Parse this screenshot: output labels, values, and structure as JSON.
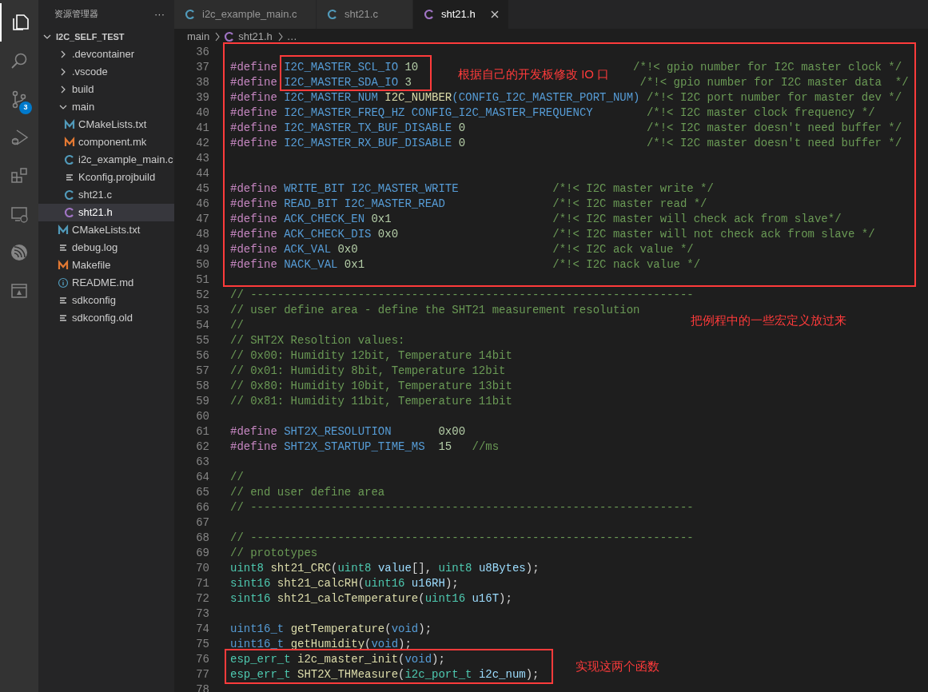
{
  "activity_bar": {
    "items": [
      {
        "kind": "files",
        "selected": true
      },
      {
        "kind": "search",
        "selected": false
      },
      {
        "kind": "scm",
        "selected": false,
        "badge": "3"
      },
      {
        "kind": "debug",
        "selected": false
      },
      {
        "kind": "extensions",
        "selected": false
      },
      {
        "kind": "remote",
        "selected": false
      },
      {
        "kind": "espressif",
        "selected": false
      },
      {
        "kind": "panel",
        "selected": false
      }
    ]
  },
  "sidebar": {
    "title": "资源管理器",
    "more": "···",
    "tree": [
      {
        "label": "I2C_SELF_TEST",
        "kind": "root",
        "expanded": true,
        "selected": false,
        "children": [
          {
            "label": ".devcontainer",
            "kind": "folder",
            "expanded": false,
            "selected": false
          },
          {
            "label": ".vscode",
            "kind": "folder",
            "expanded": false,
            "selected": false
          },
          {
            "label": "build",
            "kind": "folder",
            "expanded": false,
            "selected": false
          },
          {
            "label": "main",
            "kind": "folder",
            "expanded": true,
            "selected": false,
            "children": [
              {
                "label": "CMakeLists.txt",
                "kind": "cmake",
                "selected": false
              },
              {
                "label": "component.mk",
                "kind": "make",
                "selected": false
              },
              {
                "label": "i2c_example_main.c",
                "kind": "c",
                "selected": false
              },
              {
                "label": "Kconfig.projbuild",
                "kind": "text",
                "selected": false
              },
              {
                "label": "sht21.c",
                "kind": "c",
                "selected": false
              },
              {
                "label": "sht21.h",
                "kind": "h",
                "selected": true
              }
            ]
          },
          {
            "label": "CMakeLists.txt",
            "kind": "cmake",
            "selected": false
          },
          {
            "label": "debug.log",
            "kind": "text",
            "selected": false
          },
          {
            "label": "Makefile",
            "kind": "make",
            "selected": false
          },
          {
            "label": "README.md",
            "kind": "info",
            "selected": false
          },
          {
            "label": "sdkconfig",
            "kind": "text",
            "selected": false
          },
          {
            "label": "sdkconfig.old",
            "kind": "text",
            "selected": false
          }
        ]
      }
    ]
  },
  "tabs": [
    {
      "label": "i2c_example_main.c",
      "kind": "c",
      "selected": false
    },
    {
      "label": "sht21.c",
      "kind": "c",
      "selected": false
    },
    {
      "label": "sht21.h",
      "kind": "h",
      "selected": true
    }
  ],
  "breadcrumb": [
    {
      "label": "main",
      "kind": "folder"
    },
    {
      "label": "sht21.h",
      "kind": "h"
    },
    {
      "label": "…",
      "kind": "more"
    }
  ],
  "code": [
    {
      "number": "36"
    },
    {
      "number": "37",
      "tokens": [
        {
          "kind": "dir",
          "text": "#define "
        },
        {
          "kind": "macro",
          "text": "I2C_MASTER_SCL_IO "
        },
        {
          "kind": "num",
          "text": "10                                "
        },
        {
          "kind": "comment",
          "text": "/*!< gpio number for I2C master clock */"
        }
      ]
    },
    {
      "number": "38",
      "tokens": [
        {
          "kind": "dir",
          "text": "#define "
        },
        {
          "kind": "macro",
          "text": "I2C_MASTER_SDA_IO "
        },
        {
          "kind": "num",
          "text": "3                                  "
        },
        {
          "kind": "comment",
          "text": "/*!< gpio number for I2C master data  */"
        }
      ]
    },
    {
      "number": "39",
      "tokens": [
        {
          "kind": "dir",
          "text": "#define "
        },
        {
          "kind": "macro",
          "text": "I2C_MASTER_NUM "
        },
        {
          "kind": "func",
          "text": "I2C_NUMBER"
        },
        {
          "kind": "macro",
          "text": "(CONFIG_I2C_MASTER_PORT_NUM) "
        },
        {
          "kind": "comment",
          "text": "/*!< I2C port number for master dev */"
        }
      ]
    },
    {
      "number": "40",
      "tokens": [
        {
          "kind": "dir",
          "text": "#define "
        },
        {
          "kind": "macro",
          "text": "I2C_MASTER_FREQ_HZ CONFIG_I2C_MASTER_FREQUENCY        "
        },
        {
          "kind": "comment",
          "text": "/*!< I2C master clock frequency */"
        }
      ]
    },
    {
      "number": "41",
      "tokens": [
        {
          "kind": "dir",
          "text": "#define "
        },
        {
          "kind": "macro",
          "text": "I2C_MASTER_TX_BUF_DISABLE "
        },
        {
          "kind": "num",
          "text": "0                           "
        },
        {
          "kind": "comment",
          "text": "/*!< I2C master doesn't need buffer */"
        }
      ]
    },
    {
      "number": "42",
      "tokens": [
        {
          "kind": "dir",
          "text": "#define "
        },
        {
          "kind": "macro",
          "text": "I2C_MASTER_RX_BUF_DISABLE "
        },
        {
          "kind": "num",
          "text": "0                           "
        },
        {
          "kind": "comment",
          "text": "/*!< I2C master doesn't need buffer */"
        }
      ]
    },
    {
      "number": "43"
    },
    {
      "number": "44"
    },
    {
      "number": "45",
      "tokens": [
        {
          "kind": "dir",
          "text": "#define "
        },
        {
          "kind": "macro",
          "text": "WRITE_BIT I2C_MASTER_WRITE              "
        },
        {
          "kind": "comment",
          "text": "/*!< I2C master write */"
        }
      ]
    },
    {
      "number": "46",
      "tokens": [
        {
          "kind": "dir",
          "text": "#define "
        },
        {
          "kind": "macro",
          "text": "READ_BIT I2C_MASTER_READ                "
        },
        {
          "kind": "comment",
          "text": "/*!< I2C master read */"
        }
      ]
    },
    {
      "number": "47",
      "tokens": [
        {
          "kind": "dir",
          "text": "#define "
        },
        {
          "kind": "macro",
          "text": "ACK_CHECK_EN "
        },
        {
          "kind": "num",
          "text": "0x1                        "
        },
        {
          "kind": "comment",
          "text": "/*!< I2C master will check ack from slave*/"
        }
      ]
    },
    {
      "number": "48",
      "tokens": [
        {
          "kind": "dir",
          "text": "#define "
        },
        {
          "kind": "macro",
          "text": "ACK_CHECK_DIS "
        },
        {
          "kind": "num",
          "text": "0x0                       "
        },
        {
          "kind": "comment",
          "text": "/*!< I2C master will not check ack from slave */"
        }
      ]
    },
    {
      "number": "49",
      "tokens": [
        {
          "kind": "dir",
          "text": "#define "
        },
        {
          "kind": "macro",
          "text": "ACK_VAL "
        },
        {
          "kind": "num",
          "text": "0x0                             "
        },
        {
          "kind": "comment",
          "text": "/*!< I2C ack value */"
        }
      ]
    },
    {
      "number": "50",
      "tokens": [
        {
          "kind": "dir",
          "text": "#define "
        },
        {
          "kind": "macro",
          "text": "NACK_VAL "
        },
        {
          "kind": "num",
          "text": "0x1                            "
        },
        {
          "kind": "comment",
          "text": "/*!< I2C nack value */"
        }
      ]
    },
    {
      "number": "51"
    },
    {
      "number": "52",
      "tokens": [
        {
          "kind": "comment",
          "text": "// ------------------------------------------------------------------"
        }
      ]
    },
    {
      "number": "53",
      "tokens": [
        {
          "kind": "comment",
          "text": "// user define area - define the SHT21 measurement resolution"
        }
      ]
    },
    {
      "number": "54",
      "tokens": [
        {
          "kind": "comment",
          "text": "//"
        }
      ]
    },
    {
      "number": "55",
      "tokens": [
        {
          "kind": "comment",
          "text": "// SHT2X Resoltion values:"
        }
      ]
    },
    {
      "number": "56",
      "tokens": [
        {
          "kind": "comment",
          "text": "// 0x00: Humidity 12bit, Temperature 14bit"
        }
      ]
    },
    {
      "number": "57",
      "tokens": [
        {
          "kind": "comment",
          "text": "// 0x01: Humidity 8bit, Temperature 12bit"
        }
      ]
    },
    {
      "number": "58",
      "tokens": [
        {
          "kind": "comment",
          "text": "// 0x80: Humidity 10bit, Temperature 13bit"
        }
      ]
    },
    {
      "number": "59",
      "tokens": [
        {
          "kind": "comment",
          "text": "// 0x81: Humidity 11bit, Temperature 11bit"
        }
      ]
    },
    {
      "number": "60"
    },
    {
      "number": "61",
      "tokens": [
        {
          "kind": "dir",
          "text": "#define "
        },
        {
          "kind": "macro",
          "text": "SHT2X_RESOLUTION       "
        },
        {
          "kind": "num",
          "text": "0x00"
        }
      ]
    },
    {
      "number": "62",
      "tokens": [
        {
          "kind": "dir",
          "text": "#define "
        },
        {
          "kind": "macro",
          "text": "SHT2X_STARTUP_TIME_MS  "
        },
        {
          "kind": "num",
          "text": "15   "
        },
        {
          "kind": "comment",
          "text": "//ms"
        }
      ]
    },
    {
      "number": "63"
    },
    {
      "number": "64",
      "tokens": [
        {
          "kind": "comment",
          "text": "//"
        }
      ]
    },
    {
      "number": "65",
      "tokens": [
        {
          "kind": "comment",
          "text": "// end user define area"
        }
      ]
    },
    {
      "number": "66",
      "tokens": [
        {
          "kind": "comment",
          "text": "// ------------------------------------------------------------------"
        }
      ]
    },
    {
      "number": "67"
    },
    {
      "number": "68",
      "tokens": [
        {
          "kind": "comment",
          "text": "// ------------------------------------------------------------------"
        }
      ]
    },
    {
      "number": "69",
      "tokens": [
        {
          "kind": "comment",
          "text": "// prototypes"
        }
      ]
    },
    {
      "number": "70",
      "tokens": [
        {
          "kind": "type",
          "text": "uint8 "
        },
        {
          "kind": "func",
          "text": "sht21_CRC"
        },
        {
          "kind": "plain",
          "text": "("
        },
        {
          "kind": "type",
          "text": "uint8 "
        },
        {
          "kind": "param",
          "text": "value"
        },
        {
          "kind": "plain",
          "text": "[], "
        },
        {
          "kind": "type",
          "text": "uint8 "
        },
        {
          "kind": "param",
          "text": "u8Bytes"
        },
        {
          "kind": "plain",
          "text": ");"
        }
      ]
    },
    {
      "number": "71",
      "tokens": [
        {
          "kind": "type",
          "text": "sint16 "
        },
        {
          "kind": "func",
          "text": "sht21_calcRH"
        },
        {
          "kind": "plain",
          "text": "("
        },
        {
          "kind": "type",
          "text": "uint16 "
        },
        {
          "kind": "param",
          "text": "u16RH"
        },
        {
          "kind": "plain",
          "text": ");"
        }
      ]
    },
    {
      "number": "72",
      "tokens": [
        {
          "kind": "type",
          "text": "sint16 "
        },
        {
          "kind": "func",
          "text": "sht21_calcTemperature"
        },
        {
          "kind": "plain",
          "text": "("
        },
        {
          "kind": "type",
          "text": "uint16 "
        },
        {
          "kind": "param",
          "text": "u16T"
        },
        {
          "kind": "plain",
          "text": ");"
        }
      ]
    },
    {
      "number": "73"
    },
    {
      "number": "74",
      "tokens": [
        {
          "kind": "kw",
          "text": "uint16_t "
        },
        {
          "kind": "func",
          "text": "getTemperature"
        },
        {
          "kind": "plain",
          "text": "("
        },
        {
          "kind": "kw",
          "text": "void"
        },
        {
          "kind": "plain",
          "text": ");"
        }
      ]
    },
    {
      "number": "75",
      "tokens": [
        {
          "kind": "kw",
          "text": "uint16_t "
        },
        {
          "kind": "func",
          "text": "getHumidity"
        },
        {
          "kind": "plain",
          "text": "("
        },
        {
          "kind": "kw",
          "text": "void"
        },
        {
          "kind": "plain",
          "text": ");"
        }
      ]
    },
    {
      "number": "76",
      "tokens": [
        {
          "kind": "type",
          "text": "esp_err_t "
        },
        {
          "kind": "func",
          "text": "i2c_master_init"
        },
        {
          "kind": "plain",
          "text": "("
        },
        {
          "kind": "kw",
          "text": "void"
        },
        {
          "kind": "plain",
          "text": ");"
        }
      ]
    },
    {
      "number": "77",
      "tokens": [
        {
          "kind": "type",
          "text": "esp_err_t "
        },
        {
          "kind": "func",
          "text": "SHT2X_THMeasure"
        },
        {
          "kind": "plain",
          "text": "("
        },
        {
          "kind": "type",
          "text": "i2c_port_t "
        },
        {
          "kind": "param",
          "text": "i2c_num"
        },
        {
          "kind": "plain",
          "text": ");"
        }
      ]
    },
    {
      "number": "78"
    }
  ],
  "annotations": [
    {
      "text": "根据自己的开发板修改 IO 口"
    },
    {
      "text": "把例程中的一些宏定义放过来"
    },
    {
      "text": "实现这两个函数"
    }
  ]
}
